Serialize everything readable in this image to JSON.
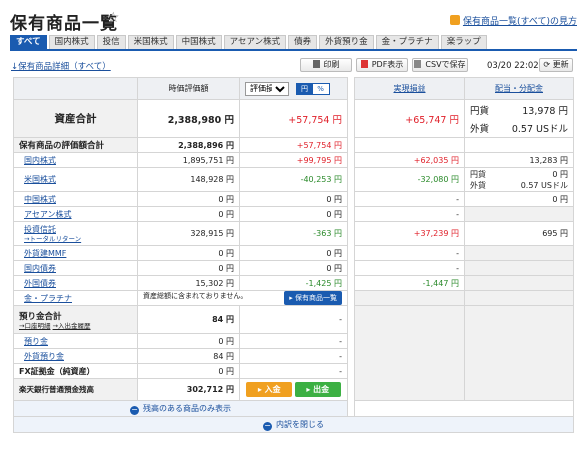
{
  "header": {
    "title": "保有商品一覧",
    "help_link": "保有商品一覧(すべて)の見方"
  },
  "tabs": [
    "すべて",
    "国内株式",
    "投信",
    "米国株式",
    "中国株式",
    "アセアン株式",
    "債券",
    "外貨預り金",
    "金・プラチナ",
    "楽ラップ"
  ],
  "toolbar": {
    "detail_link": "↓保有商品詳細（すべて）",
    "print": "印刷",
    "pdf": "PDF表示",
    "csv": "CSVで保存",
    "datetime": "03/20 22:02",
    "refresh": "更新"
  },
  "columns": {
    "valuation": "時価評価額",
    "pl_select": "評価損益",
    "yen": "円",
    "pct": "%",
    "realized": "実現損益",
    "dividend": "配当・分配金"
  },
  "asset_total": {
    "label": "資産合計",
    "valuation": "2,388,980 円",
    "pl": "+57,754 円",
    "realized": "+65,747 円",
    "div_yen_label": "円貨",
    "div_yen": "13,978 円",
    "div_fx_label": "外貨",
    "div_fx": "0.57 USドル"
  },
  "holdings": {
    "label": "保有商品の評価額合計",
    "valuation": "2,388,896 円",
    "pl": "+57,754 円",
    "rows": [
      {
        "name": "国内株式",
        "sub": "",
        "valuation": "1,895,751 円",
        "pl": "+99,795 円",
        "pl_color": "red",
        "realized": "+62,035 円",
        "realized_color": "red",
        "div": "13,283 円"
      },
      {
        "name": "米国株式",
        "sub": "",
        "valuation": "148,928 円",
        "pl": "-40,253 円",
        "pl_color": "green",
        "realized": "-32,080 円",
        "realized_color": "green",
        "div_yen_label": "円貨",
        "div_yen": "0 円",
        "div_fx_label": "外貨",
        "div_fx": "0.57 USドル"
      },
      {
        "name": "中国株式",
        "sub": "",
        "valuation": "0 円",
        "pl": "0 円",
        "pl_color": "",
        "realized": "-",
        "realized_color": "",
        "div": "0 円"
      },
      {
        "name": "アセアン株式",
        "sub": "",
        "valuation": "0 円",
        "pl": "0 円",
        "pl_color": "",
        "realized": "-",
        "realized_color": "",
        "div": ""
      },
      {
        "name": "投資信託",
        "sub": "→トータルリターン",
        "valuation": "328,915 円",
        "pl": "-363 円",
        "pl_color": "green",
        "realized": "+37,239 円",
        "realized_color": "red",
        "div": "695 円"
      },
      {
        "name": "外貨建MMF",
        "sub": "",
        "valuation": "0 円",
        "pl": "0 円",
        "pl_color": "",
        "realized": "-",
        "realized_color": "",
        "div": ""
      },
      {
        "name": "国内債券",
        "sub": "",
        "valuation": "0 円",
        "pl": "0 円",
        "pl_color": "",
        "realized": "-",
        "realized_color": "",
        "div": ""
      },
      {
        "name": "外国債券",
        "sub": "",
        "valuation": "15,302 円",
        "pl": "-1,425 円",
        "pl_color": "green",
        "realized": "-1,447 円",
        "realized_color": "green",
        "div": ""
      }
    ],
    "gold": {
      "name": "金・プラチナ",
      "note": "資産総額に含まれておりません。",
      "button": "保有商品一覧"
    }
  },
  "deposits": {
    "label": "預り金合計",
    "sub1": "→口座明細",
    "sub2": "→入出金履歴",
    "valuation": "84 円",
    "pl": "-",
    "rows": [
      {
        "name": "預り金",
        "valuation": "0 円",
        "pl": "-"
      },
      {
        "name": "外貨預り金",
        "valuation": "84 円",
        "pl": "-"
      }
    ]
  },
  "fx": {
    "label": "FX証拠金（純資産）",
    "valuation": "0 円",
    "pl": "-"
  },
  "bank": {
    "label": "楽天銀行普通預金残高",
    "valuation": "302,712 円",
    "deposit_btn": "入金",
    "withdraw_btn": "出金"
  },
  "footer": {
    "show_balance": "残高のある商品のみ表示",
    "close": "内訳を閉じる"
  },
  "colors": {
    "accent": "#1a5bb0",
    "positive": "#e0202a",
    "negative": "#2a8a2a",
    "deposit": "#f0a020",
    "withdraw": "#3cb043"
  }
}
